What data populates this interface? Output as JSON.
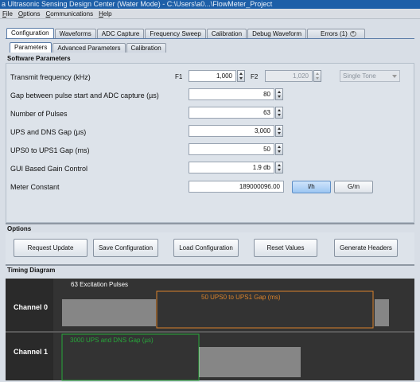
{
  "window": {
    "title": "a Ultrasonic Sensing Design Center (Water Mode) - C:\\Users\\a0...\\FlowMeter_Project"
  },
  "menu": {
    "items": [
      "File",
      "Options",
      "Communications",
      "Help"
    ]
  },
  "main_tabs": [
    "Configuration",
    "Waveforms",
    "ADC Capture",
    "Frequency Sweep",
    "Calibration",
    "Debug Waveform",
    "Errors (1)"
  ],
  "sub_tabs": [
    "Parameters",
    "Advanced Parameters",
    "Calibration"
  ],
  "sections": {
    "software": "Software Parameters",
    "options": "Options",
    "timing": "Timing Diagram"
  },
  "params": {
    "transmit_frequency": {
      "label": "Transmit frequency (kHz)",
      "f1_label": "F1",
      "f1_value": "1,000",
      "f2_label": "F2",
      "f2_value": "1,020",
      "mode": "Single Tone"
    },
    "gap_adc": {
      "label": "Gap between pulse start and ADC capture (µs)",
      "value": "80"
    },
    "num_pulses": {
      "label": "Number of Pulses",
      "value": "63"
    },
    "ups_dns_gap": {
      "label": "UPS and DNS Gap (µs)",
      "value": "3,000"
    },
    "ups0_ups1_gap": {
      "label": "UPS0 to UPS1 Gap (ms)",
      "value": "50"
    },
    "gain_control": {
      "label": "GUI Based Gain Control",
      "value": "1.9 db"
    },
    "meter_constant": {
      "label": "Meter Constant",
      "value": "189000096.00",
      "unit_a": "l/h",
      "unit_b": "G/m"
    }
  },
  "options": {
    "buttons": [
      "Request Update",
      "Save Configuration",
      "Load Configuration",
      "Reset Values",
      "Generate Headers"
    ]
  },
  "timing": {
    "channel0": "Channel 0",
    "channel1": "Channel 1",
    "pulses_label": "63 Excitation Pulses",
    "ups_gap_label": "50 UPS0 to UPS1 Gap (ms)",
    "dns_gap_label": "3000 UPS and DNS Gap (µs)"
  },
  "colors": {
    "accent": "#1d5fa8",
    "orange": "#d9822b",
    "green": "#27a83a",
    "pulse": "#d8d8d8"
  }
}
